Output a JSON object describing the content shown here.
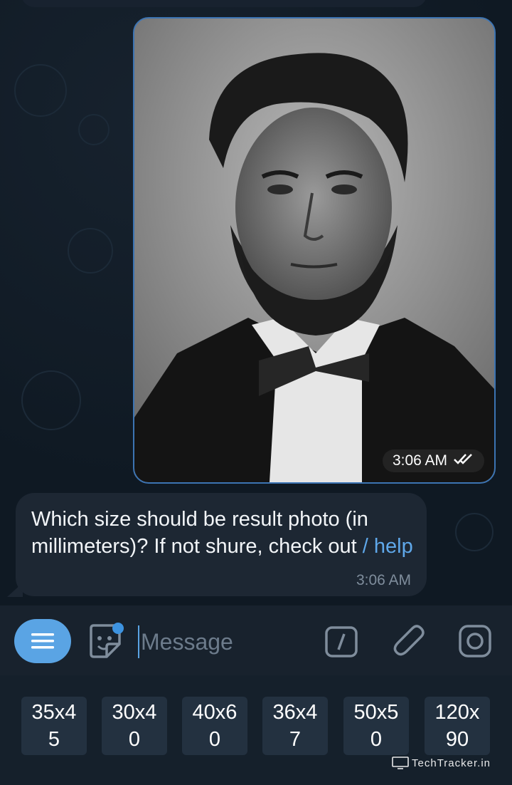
{
  "photo_message": {
    "time": "3:06 AM",
    "status_icon": "double-check-icon"
  },
  "text_message": {
    "text": "Which size should be result photo (in millimeters)? If not shure, check out ",
    "link": "/ help",
    "time": "3:06 AM"
  },
  "input_bar": {
    "placeholder": "Message",
    "icons": [
      "menu-icon",
      "sticker-icon",
      "slash-command-icon",
      "paperclip-icon",
      "camera-icon"
    ]
  },
  "keyboard": {
    "buttons": [
      {
        "label": "35x4\n5"
      },
      {
        "label": "30x4\n0"
      },
      {
        "label": "40x6\n0"
      },
      {
        "label": "36x4\n7"
      },
      {
        "label": "50x5\n0"
      },
      {
        "label": "120x\n90"
      }
    ]
  },
  "watermark": {
    "text": "TechTracker.in"
  },
  "colors": {
    "accent": "#5aa4e4",
    "bubble": "#1d2733",
    "background": "#0f1923",
    "photo_border": "#3c74b3"
  }
}
